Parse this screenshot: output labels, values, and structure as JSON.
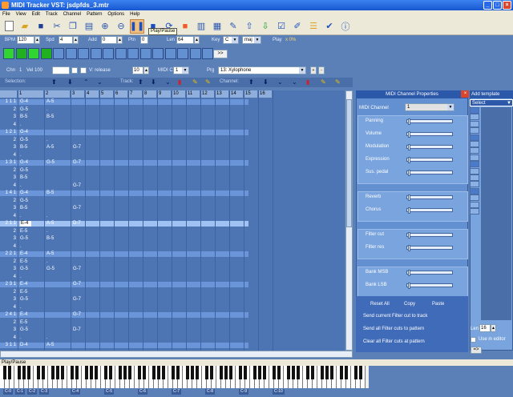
{
  "window": {
    "title": "MIDI Tracker VST: jsdpfds_3.mtr"
  },
  "menu": [
    "File",
    "View",
    "Edit",
    "Track",
    "Channel",
    "Pattern",
    "Options",
    "Help"
  ],
  "tooltip": "Play/Pause",
  "controls": {
    "bpm_label": "BPM",
    "bpm": "120",
    "spd_label": "Spd",
    "spd": "4",
    "add_label": "Add",
    "add": "0",
    "ptn_label": "Ptn",
    "ptn": "0",
    "len_label": "Len",
    "len": "64",
    "key_label": "Key",
    "key": "C",
    "scale": "maj",
    "play_label": "Play",
    "play_value": "x 0%"
  },
  "pattern_play_button": ">>",
  "channel_row": {
    "chn_label": "Chn",
    "chn": "1",
    "vel_label": "Vel 100",
    "release_label": "V: release",
    "release_value": "10",
    "midi_chn_label": "MIDI Chn",
    "midi_chn": "1",
    "prg_label": "Prg",
    "prg": "13: Xylophone"
  },
  "toolrow": {
    "selection": "Selection:",
    "track": "Track:",
    "channel": "Channel:"
  },
  "grid": {
    "columns": [
      "1",
      "2",
      "3",
      "4",
      "5",
      "6",
      "7",
      "8",
      "9",
      "10",
      "11",
      "12",
      "13",
      "14",
      "15",
      "16"
    ],
    "rows": [
      {
        "n": "1 1 1",
        "c1": "G-4",
        "c2": "A-5",
        "c3": "",
        "hl": true,
        "sel": false
      },
      {
        "n": "2",
        "c1": "G-5",
        "c2": ".",
        "c3": ""
      },
      {
        "n": "3",
        "c1": "B-5",
        "c2": "B-5",
        "c3": ""
      },
      {
        "n": "4",
        "c1": ".",
        "c2": "",
        "c3": ""
      },
      {
        "n": "1 2 1",
        "c1": "G-4",
        "c2": "",
        "c3": "",
        "hl": true
      },
      {
        "n": "2",
        "c1": "G-5",
        "c2": ".",
        "c3": ""
      },
      {
        "n": "3",
        "c1": "B-5",
        "c2": "A-5",
        "c3": "G-7"
      },
      {
        "n": "4",
        "c1": ".",
        "c2": "",
        "c3": ""
      },
      {
        "n": "1 3 1",
        "c1": "G-4",
        "c2": "G-5",
        "c3": "G-7",
        "hl": true
      },
      {
        "n": "2",
        "c1": "G-5",
        "c2": "",
        "c3": ""
      },
      {
        "n": "3",
        "c1": "B-5",
        "c2": "",
        "c3": ""
      },
      {
        "n": "4",
        "c1": ".",
        "c2": "",
        "c3": "G-7"
      },
      {
        "n": "1 4 1",
        "c1": "G-4",
        "c2": "B-5",
        "c3": "",
        "hl": true
      },
      {
        "n": "2",
        "c1": "G-5",
        "c2": "",
        "c3": ""
      },
      {
        "n": "3",
        "c1": "B-5",
        "c2": "",
        "c3": "G-7"
      },
      {
        "n": "4",
        "c1": ".",
        "c2": ".",
        "c3": ""
      },
      {
        "n": "2 1 1",
        "c1": "E-4",
        "c2": "A-5",
        "c3": "D-7",
        "hl": true,
        "sel": true
      },
      {
        "n": "2",
        "c1": "E-5",
        "c2": ".",
        "c3": ""
      },
      {
        "n": "3",
        "c1": "G-5",
        "c2": "B-5",
        "c3": ""
      },
      {
        "n": "4",
        "c1": ".",
        "c2": "",
        "c3": ""
      },
      {
        "n": "2 2 1",
        "c1": "E-4",
        "c2": "A-5",
        "c3": "",
        "hl": true
      },
      {
        "n": "2",
        "c1": "E-5",
        "c2": ".",
        "c3": ""
      },
      {
        "n": "3",
        "c1": "G-5",
        "c2": "G-5",
        "c3": "G-7"
      },
      {
        "n": "4",
        "c1": ".",
        "c2": "",
        "c3": ""
      },
      {
        "n": "2 3 1",
        "c1": "E-4",
        "c2": "",
        "c3": "G-7",
        "hl": true
      },
      {
        "n": "2",
        "c1": "E-5",
        "c2": "",
        "c3": ""
      },
      {
        "n": "3",
        "c1": "G-5",
        "c2": "",
        "c3": "G-7"
      },
      {
        "n": "4",
        "c1": ".",
        "c2": "",
        "c3": ""
      },
      {
        "n": "2 4 1",
        "c1": "E-4",
        "c2": "",
        "c3": "G-7",
        "hl": true
      },
      {
        "n": "2",
        "c1": "E-5",
        "c2": "",
        "c3": ""
      },
      {
        "n": "3",
        "c1": "G-5",
        "c2": "",
        "c3": "D-7"
      },
      {
        "n": "4",
        "c1": ".",
        "c2": ".",
        "c3": ""
      },
      {
        "n": "3 1 1",
        "c1": "D-4",
        "c2": "A-5",
        "c3": "",
        "hl": true
      }
    ]
  },
  "channel_props": {
    "title": "MIDI Channel Properties",
    "midi_channel_label": "MIDI Channel",
    "midi_channel": "1",
    "sliders1": [
      {
        "label": "Panning",
        "value": 0.02
      },
      {
        "label": "Volume",
        "value": 0.02
      },
      {
        "label": "Modulation",
        "value": 0.02
      },
      {
        "label": "Expression",
        "value": 0.02
      },
      {
        "label": "Sus. pedal",
        "value": 0.02
      }
    ],
    "sliders2": [
      {
        "label": "Reverb",
        "value": 0.02
      },
      {
        "label": "Chorus",
        "value": 0.02
      }
    ],
    "sliders3": [
      {
        "label": "Filter cut",
        "value": 0.02
      },
      {
        "label": "Filter res",
        "value": 0.02
      }
    ],
    "sliders4": [
      {
        "label": "Bank MSB",
        "value": 0.02
      },
      {
        "label": "Bank LSB",
        "value": 0.02
      }
    ],
    "reset_all": "Reset All",
    "copy": "Copy",
    "paste": "Paste",
    "send_filter_track": "Send current Filter cut to track",
    "send_filter_pattern": "Send all Filter cuts to pattern",
    "clear_filter_pattern": "Clear all Filter cuts at pattern"
  },
  "template": {
    "title": "Add template",
    "select": "Select",
    "len_label": "Len",
    "len": "16",
    "use_in_editor": "Use in editor",
    "go": "=>"
  },
  "status": "Play/Pause",
  "piano": {
    "octaves": [
      "C-0",
      "C-1",
      "C-2",
      "C-3",
      "C-4",
      "C-5",
      "C-6",
      "C-7",
      "C-8",
      "C-9",
      "C-10"
    ]
  }
}
